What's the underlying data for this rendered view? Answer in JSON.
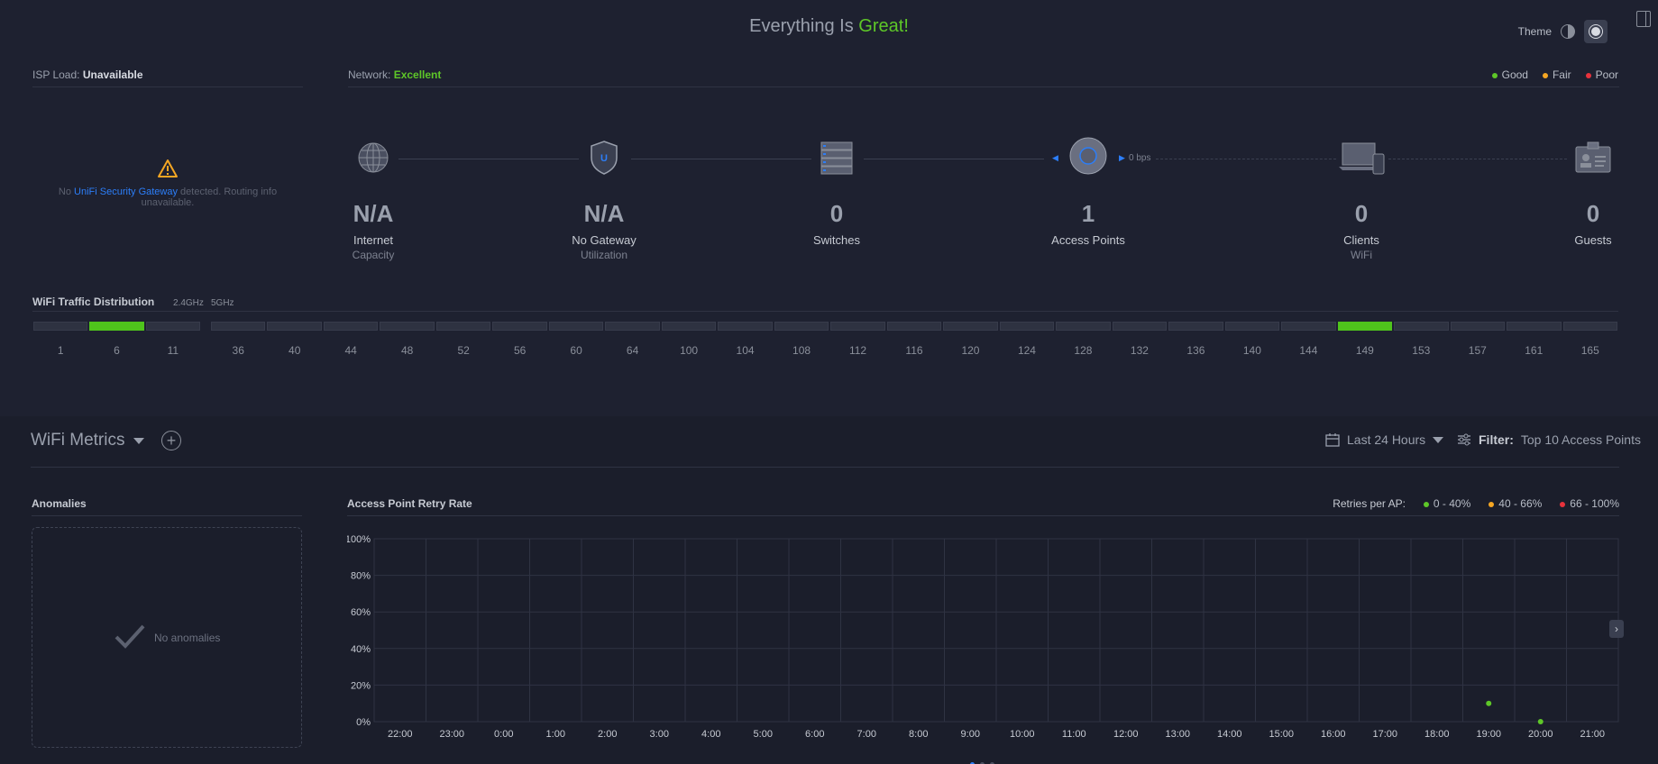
{
  "header": {
    "status_prefix": "Everything Is",
    "status_value": "Great!",
    "theme_label": "Theme"
  },
  "isp": {
    "label": "ISP Load:",
    "value": "Unavailable",
    "warning": {
      "prefix": "No",
      "link": "UniFi Security Gateway",
      "suffix": "detected. Routing info unavailable."
    }
  },
  "network": {
    "label": "Network:",
    "value": "Excellent",
    "legend": [
      {
        "label": "Good",
        "color": "#5ec728"
      },
      {
        "label": "Fair",
        "color": "#f5a623"
      },
      {
        "label": "Poor",
        "color": "#e8323c"
      }
    ]
  },
  "topology": {
    "rate": "0 bps",
    "nodes": [
      {
        "icon": "globe-icon",
        "value": "N/A",
        "label": "Internet",
        "sub": "Capacity"
      },
      {
        "icon": "gateway-shield-icon",
        "value": "N/A",
        "label": "No Gateway",
        "sub": "Utilization"
      },
      {
        "icon": "switch-stack-icon",
        "value": "0",
        "label": "Switches",
        "sub": ""
      },
      {
        "icon": "access-point-icon",
        "value": "1",
        "label": "Access Points",
        "sub": ""
      },
      {
        "icon": "laptop-phone-icon",
        "value": "0",
        "label": "Clients",
        "sub": "WiFi"
      },
      {
        "icon": "guest-badge-icon",
        "value": "0",
        "label": "Guests",
        "sub": ""
      }
    ]
  },
  "wifi_traffic": {
    "title": "WiFi Traffic Distribution",
    "band_24": "2.4GHz",
    "band_5": "5GHz",
    "channels_24": [
      "1",
      "6",
      "11"
    ],
    "active_24": [
      "6"
    ],
    "channels_5": [
      "36",
      "40",
      "44",
      "48",
      "52",
      "56",
      "60",
      "64",
      "100",
      "104",
      "108",
      "112",
      "116",
      "120",
      "124",
      "128",
      "132",
      "136",
      "140",
      "144",
      "149",
      "153",
      "157",
      "161",
      "165"
    ],
    "active_5": [
      "149"
    ]
  },
  "metrics": {
    "title": "WiFi Metrics",
    "range_label": "Last 24 Hours",
    "filter_label": "Filter:",
    "filter_value": "Top 10 Access Points",
    "anomalies": {
      "title": "Anomalies",
      "empty": "No anomalies"
    },
    "retry": {
      "title": "Access Point Retry Rate",
      "legend_title": "Retries per AP:",
      "legend": [
        {
          "label": "0 - 40%",
          "color": "#5ec728"
        },
        {
          "label": "40 - 66%",
          "color": "#f5a623"
        },
        {
          "label": "66 - 100%",
          "color": "#e8323c"
        }
      ]
    }
  },
  "chart_data": {
    "type": "scatter",
    "title": "Access Point Retry Rate",
    "x_categories": [
      "22:00",
      "23:00",
      "0:00",
      "1:00",
      "2:00",
      "3:00",
      "4:00",
      "5:00",
      "6:00",
      "7:00",
      "8:00",
      "9:00",
      "10:00",
      "11:00",
      "12:00",
      "13:00",
      "14:00",
      "15:00",
      "16:00",
      "17:00",
      "18:00",
      "19:00",
      "20:00",
      "21:00"
    ],
    "y_ticks": [
      "0%",
      "20%",
      "40%",
      "60%",
      "80%",
      "100%"
    ],
    "ylim": [
      0,
      100
    ],
    "grid": true,
    "series": [
      {
        "color": "#5ec728",
        "points": [
          {
            "x": "19:00",
            "y": 10
          },
          {
            "x": "20:00",
            "y": 0
          }
        ]
      }
    ]
  }
}
